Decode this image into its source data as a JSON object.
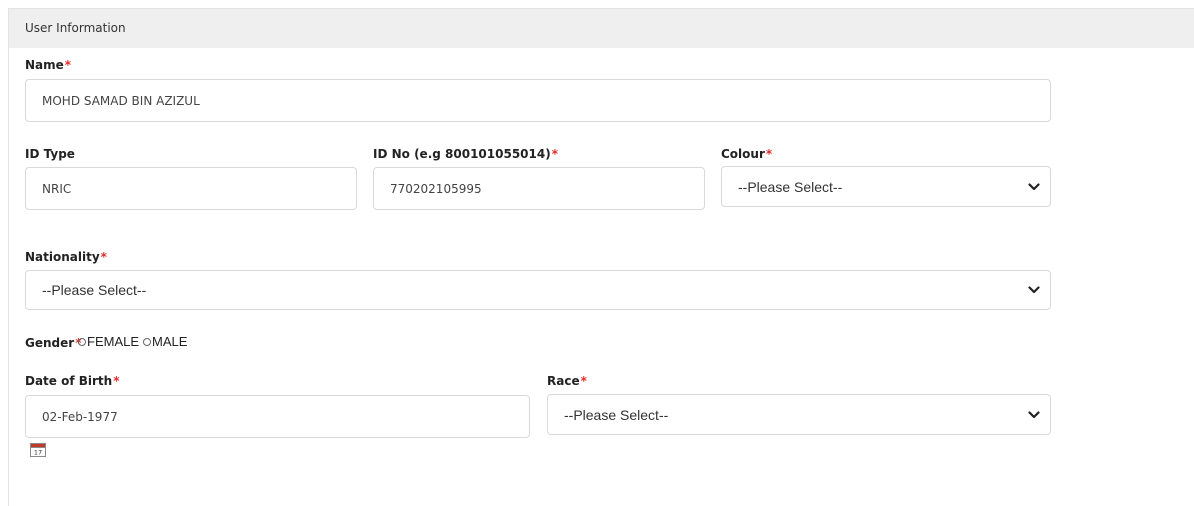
{
  "panel": {
    "title": "User Information"
  },
  "form": {
    "name": {
      "label": "Name",
      "required_mark": "*",
      "value": "MOHD SAMAD BIN AZIZUL"
    },
    "id_type": {
      "label": "ID Type",
      "value": "NRIC"
    },
    "id_no": {
      "label": "ID No (e.g 800101055014)",
      "required_mark": "*",
      "value": "770202105995"
    },
    "colour": {
      "label": "Colour",
      "required_mark": "*",
      "selected": "--Please Select--"
    },
    "nationality": {
      "label": "Nationality",
      "required_mark": "*",
      "selected": "--Please Select--"
    },
    "gender": {
      "label": "Gender",
      "required_mark": "*",
      "options": [
        "FEMALE",
        "MALE"
      ]
    },
    "dob": {
      "label": "Date of Birth",
      "required_mark": "*",
      "value": "02-Feb-1977",
      "calendar_day": "17"
    },
    "race": {
      "label": "Race",
      "required_mark": "*",
      "selected": "--Please Select--"
    }
  },
  "colors": {
    "required": "#e02b2b",
    "header_bg": "#efefef",
    "field_border": "#d9d9d9"
  },
  "icons": {
    "select_arrow": "chevron-down-icon",
    "calendar": "calendar-icon"
  }
}
